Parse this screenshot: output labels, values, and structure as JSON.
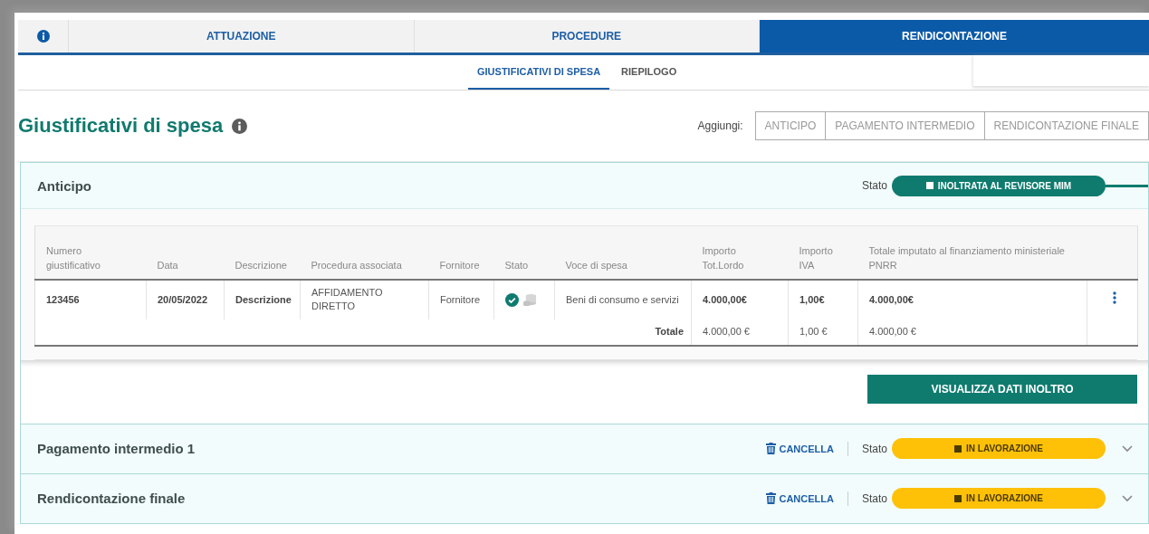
{
  "tabs": [
    {
      "label": "ATTUAZIONE",
      "selected": false
    },
    {
      "label": "PROCEDURE",
      "selected": false
    },
    {
      "label": "RENDICONTAZIONE",
      "selected": true
    }
  ],
  "subtabs": [
    {
      "label": "GIUSTIFICATIVI DI SPESA",
      "selected": true
    },
    {
      "label": "RIEPILOGO",
      "selected": false
    }
  ],
  "page_title": "Giustificativi di spesa",
  "add": {
    "label": "Aggiungi:",
    "buttons": [
      "ANTICIPO",
      "PAGAMENTO INTERMEDIO",
      "RENDICONTAZIONE FINALE"
    ]
  },
  "sections": [
    {
      "title": "Anticipo",
      "expanded": true,
      "status_label": "Stato",
      "status": {
        "label": "INOLTRATA AL REVISORE MIM",
        "kind": "forwarded",
        "color": "#0f7b6f"
      },
      "table": {
        "columns": [
          "Numero giustificativo",
          "Data",
          "Descrizione",
          "Procedura associata",
          "Fornitore",
          "Stato",
          "Voce di spesa",
          "Importo Tot.Lordo",
          "Importo IVA",
          "Totale imputato al finanziamento ministeriale PNRR"
        ],
        "rows": [
          {
            "number": "123456",
            "date": "20/05/2022",
            "description": "Descrizione",
            "procedure": "AFFIDAMENTO DIRETTO",
            "supplier": "Fornitore",
            "voice": "Beni di consumo e servizi",
            "gross": "4.000,00€",
            "vat": "1,00€",
            "total": "4.000,00€"
          }
        ],
        "totals": {
          "label": "Totale",
          "gross": "4.000,00 €",
          "vat": "1,00 €",
          "total": "4.000,00 €"
        }
      },
      "action": "VISUALIZZA DATI INOLTRO"
    },
    {
      "title": "Pagamento intermedio 1",
      "expanded": false,
      "cancel": "CANCELLA",
      "status_label": "Stato",
      "status": {
        "label": "IN LAVORAZIONE",
        "kind": "in_progress",
        "color": "#ffc107"
      }
    },
    {
      "title": "Rendicontazione finale",
      "expanded": false,
      "cancel": "CANCELLA",
      "status_label": "Stato",
      "status": {
        "label": "IN LAVORAZIONE",
        "kind": "in_progress",
        "color": "#ffc107"
      }
    }
  ]
}
